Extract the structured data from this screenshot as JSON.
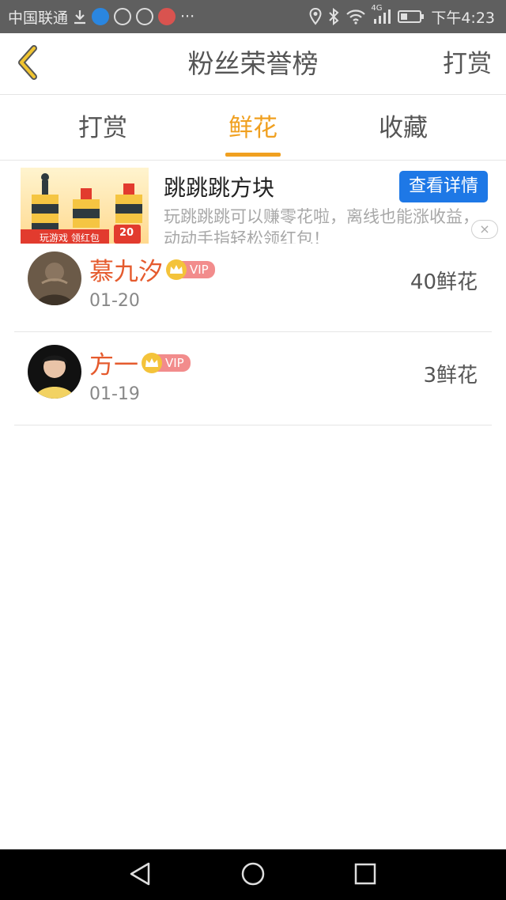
{
  "status_bar": {
    "carrier": "中国联通",
    "more": "···",
    "network": "4G",
    "time": "下午4:23"
  },
  "header": {
    "title": "粉丝荣誉榜",
    "action": "打赏"
  },
  "tabs": [
    {
      "label": "打赏",
      "active": false
    },
    {
      "label": "鲜花",
      "active": true
    },
    {
      "label": "收藏",
      "active": false
    }
  ],
  "ad": {
    "title": "跳跳跳方块",
    "description": "玩跳跳跳可以赚零花啦，离线也能涨收益，动动手指轻松领红包！",
    "button": "查看详情",
    "image_caption": "玩游戏 领红包",
    "image_badge": "20",
    "close": "×"
  },
  "fans": [
    {
      "name": "慕九汐",
      "badge": "VIP",
      "date": "01-20",
      "amount": "40鲜花"
    },
    {
      "name": "方一",
      "badge": "VIP",
      "date": "01-19",
      "amount": "3鲜花"
    }
  ],
  "colors": {
    "accent": "#f0a020",
    "name": "#e55b2e",
    "ad_button": "#1e78e6"
  }
}
